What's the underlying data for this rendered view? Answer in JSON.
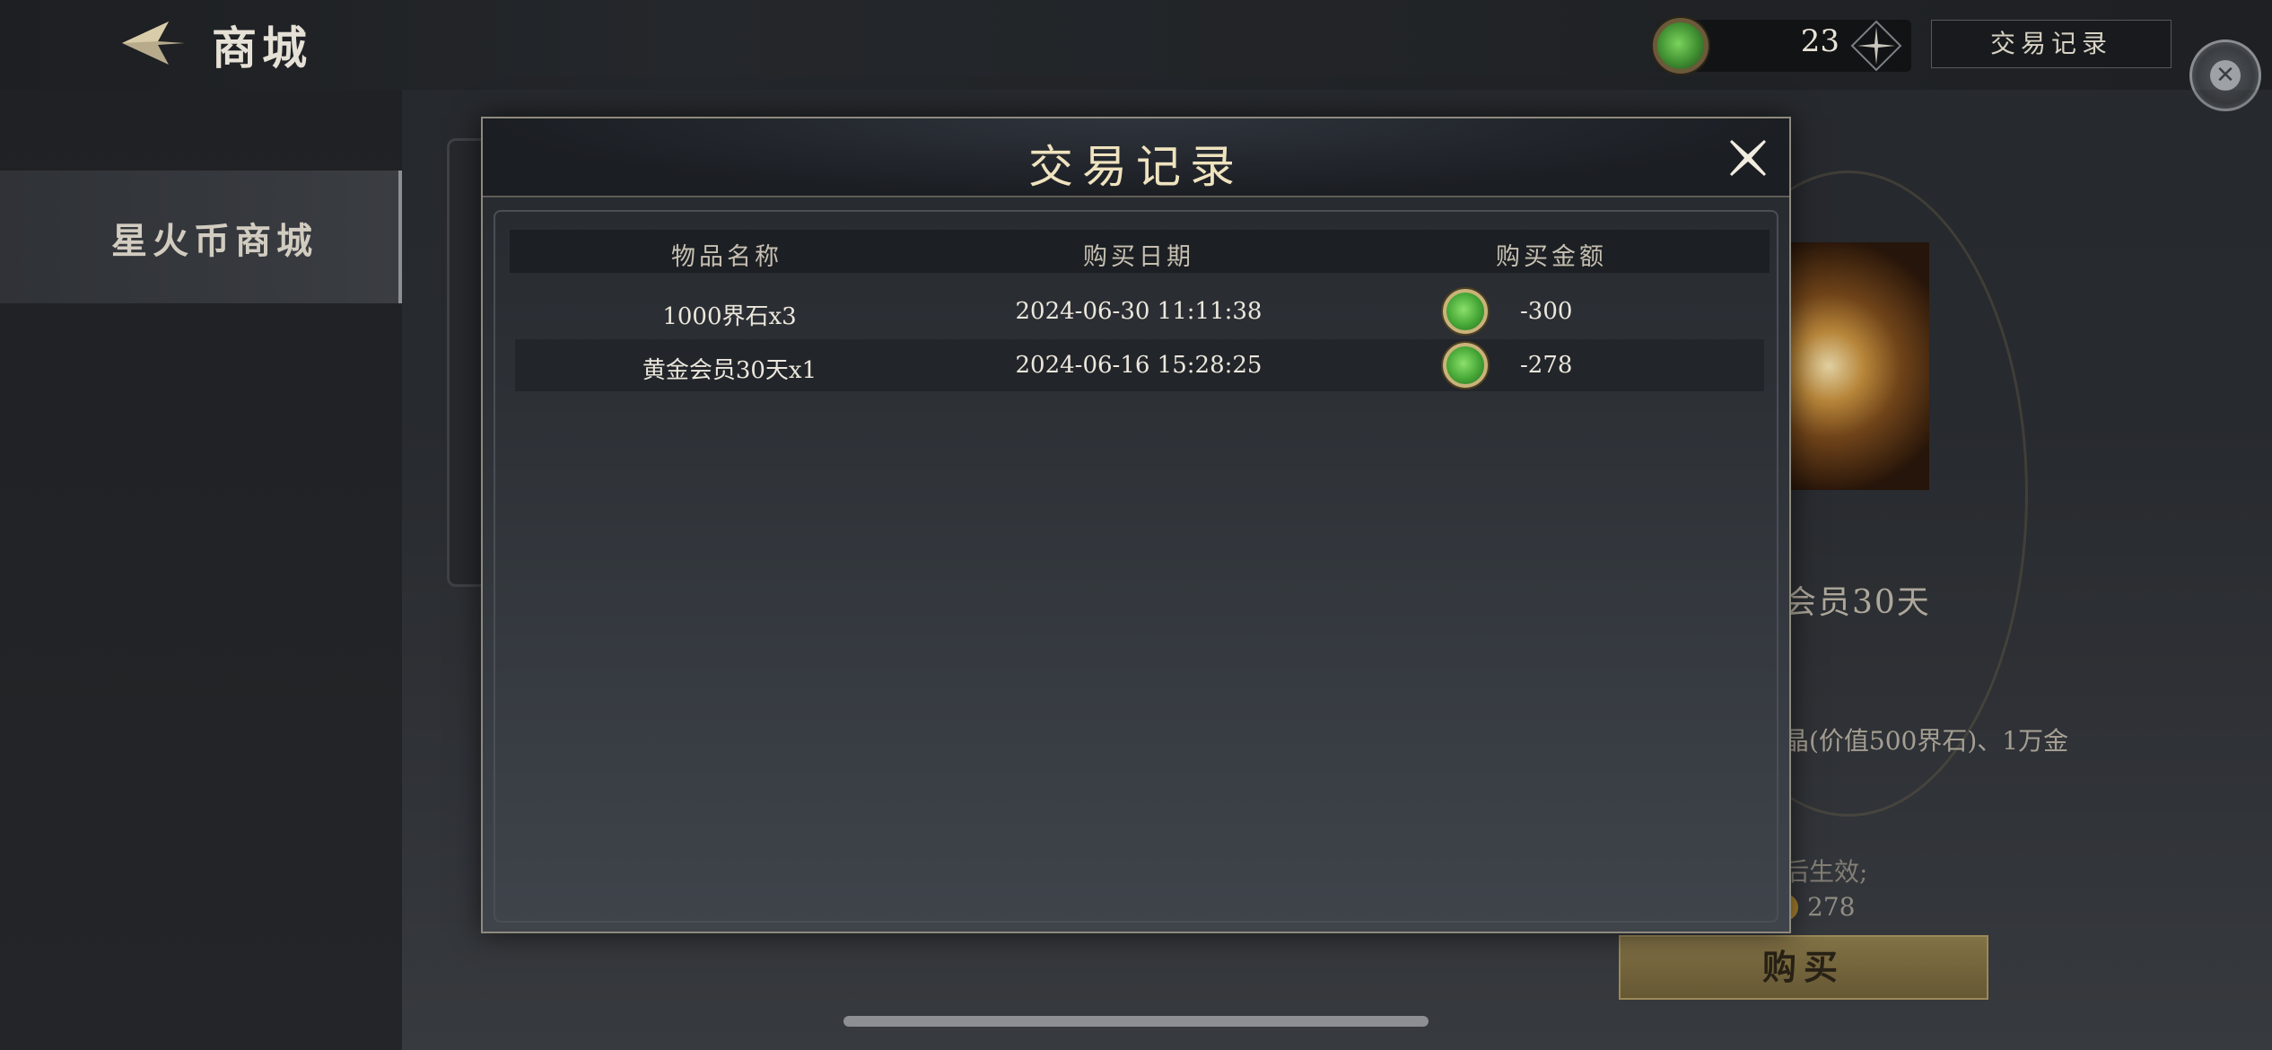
{
  "header": {
    "title": "商城",
    "currency_amount": "23",
    "history_button": "交易记录"
  },
  "sidebar": {
    "items": [
      {
        "label": "星火币商城"
      }
    ]
  },
  "product": {
    "name_partial": "会员30天",
    "desc_partial": "晶(价值500界石)、1万金",
    "effect_partial": "后生效;",
    "price": "278",
    "buy_label": "购买"
  },
  "modal": {
    "title": "交易记录",
    "columns": [
      "物品名称",
      "购买日期",
      "购买金额"
    ],
    "rows": [
      {
        "name": "1000界石x3",
        "date": "2024-06-30 11:11:38",
        "amount": "-300"
      },
      {
        "name": "黄金会员30天x1",
        "date": "2024-06-16 15:28:25",
        "amount": "-278"
      }
    ]
  },
  "icons": {
    "back": "back-arrow-icon",
    "coin": "star-coin-icon",
    "plus": "plus-icon",
    "close": "close-icon"
  },
  "colors": {
    "accent_gold": "#efe3bf",
    "coin_green": "#45a636",
    "buy_button": "#8d7c4c"
  }
}
